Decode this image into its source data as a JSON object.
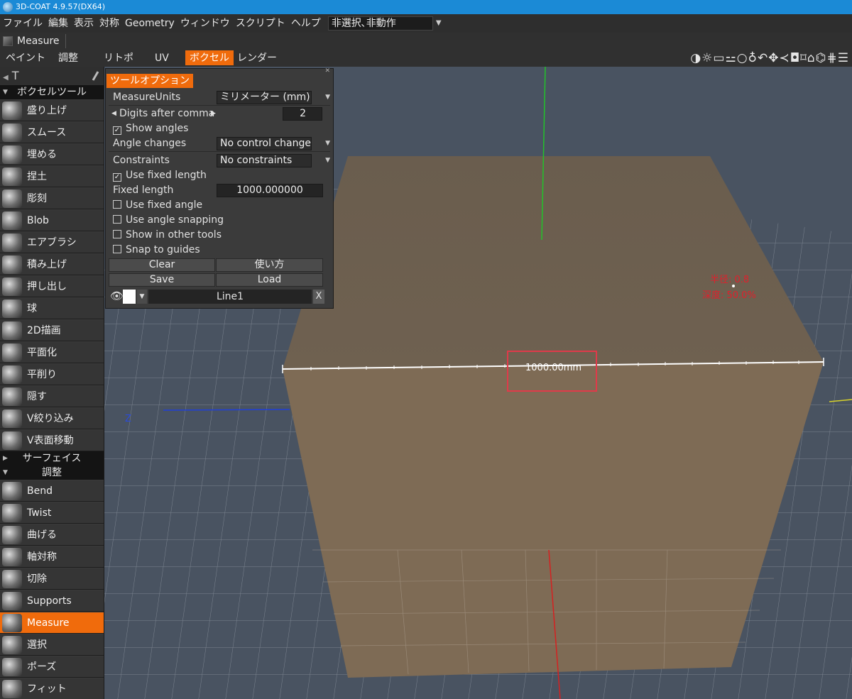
{
  "title": {
    "text": "3D-COAT 4.9.57(DX64)"
  },
  "menu": [
    "ファイル",
    "編集",
    "表示",
    "対称",
    "Geometry",
    "ウィンドウ",
    "スクリプト",
    "ヘルプ"
  ],
  "menu_select": "非選択､非動作",
  "tool": "Measure",
  "rooms": {
    "tabs": [
      "ペイント",
      "調整",
      "リトポ",
      "UV",
      "ボクセル",
      "レンダー"
    ],
    "active": "ボクセル"
  },
  "right_icons": "◑☼▭⚍○♁↶✥≺◘⌑⌂⌬⋕☰",
  "sidebar": {
    "t_icon": "T",
    "voxel_header": "ボクセルツール",
    "voxel_tools": [
      "盛り上げ",
      "スムース",
      "埋める",
      "捏土",
      "彫刻",
      "Blob",
      "エアブラシ",
      "積み上げ",
      "押し出し",
      "球",
      "2D描画",
      "平面化",
      "平削り",
      "隠す",
      "V絞り込み",
      "V表面移動"
    ],
    "surface_header": "サーフェイス",
    "adjust_header": "調整",
    "adjust_tools": [
      "Bend",
      "Twist",
      "曲げる",
      "軸対称",
      "切除",
      "Supports",
      "Measure",
      "選択",
      "ポーズ",
      "フィット"
    ],
    "active_tool": "Measure"
  },
  "panel": {
    "title": "ツールオプション",
    "measure_units_label": "MeasureUnits",
    "measure_units_value": "ミリメーター (mm)",
    "digits_label": "Digits after comma",
    "digits_value": "2",
    "show_angles_label": "Show angles",
    "show_angles": true,
    "angle_changes_label": "Angle changes",
    "angle_changes_value": "No control changes",
    "constraints_label": "Constraints",
    "constraints_value": "No constraints",
    "use_fixed_length_label": "Use fixed length",
    "use_fixed_length": true,
    "fixed_length_label": "Fixed length",
    "fixed_length_value": "1000.000000",
    "use_fixed_angle_label": "Use fixed angle",
    "use_fixed_angle": false,
    "use_angle_snapping_label": "Use angle snapping",
    "use_angle_snapping": false,
    "show_in_other_tools_label": "Show in other tools",
    "show_in_other_tools": false,
    "snap_to_guides_label": "Snap to guides",
    "snap_to_guides": false,
    "clear_label": "Clear",
    "howto_label": "使い方",
    "save_label": "Save",
    "load_label": "Load",
    "line_name": "Line1",
    "close_label": "X"
  },
  "viewport": {
    "axis_z_label": "Z",
    "measure_text": "1000.00mm",
    "radius_text": "半径: 0.8",
    "depth_text": "深度: 50.0%",
    "colors": {
      "box_top": "#6e6150",
      "box_front": "#7e6b55",
      "background": "#495361",
      "grid": "#a4abb4",
      "annotation": "#e0202c",
      "highlight": "#e03a4a"
    }
  }
}
